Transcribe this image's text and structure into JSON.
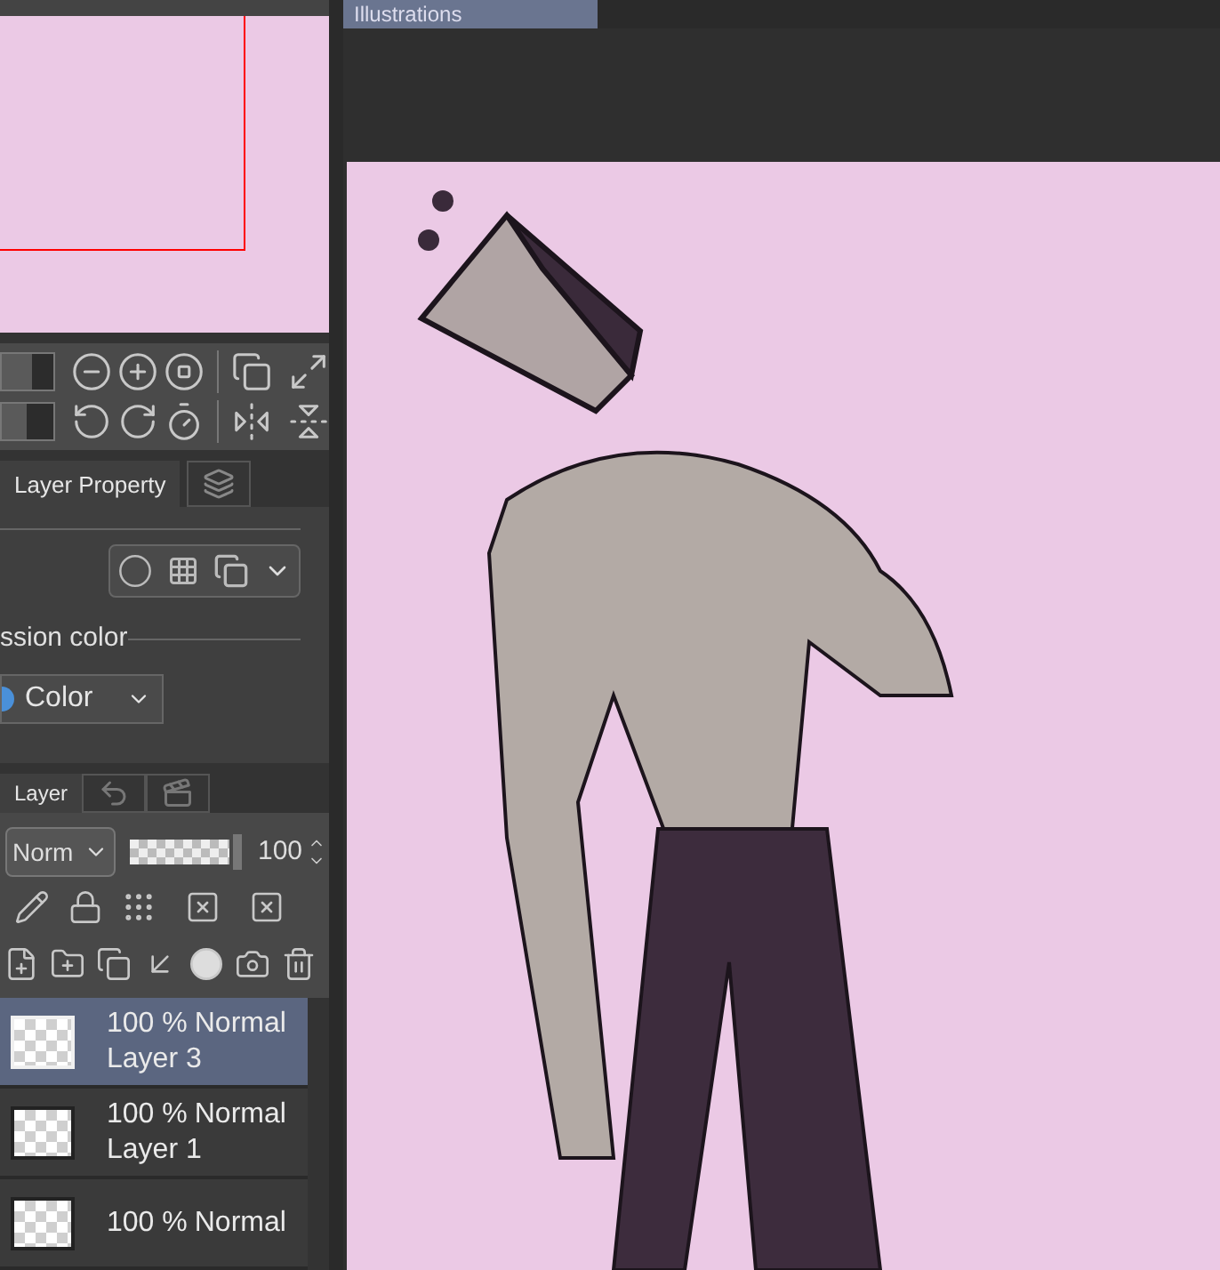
{
  "document_tab": {
    "title": "Illustrations",
    "selected": true
  },
  "zoom_slider": {
    "level": 0.6
  },
  "rotate_slider": {
    "level": 0.5
  },
  "property_tabs": [
    {
      "kind": "text",
      "label": "Layer Property",
      "selected": true
    },
    {
      "kind": "icon",
      "selected": false
    }
  ],
  "layer_property": {
    "expression_label": "ssion color",
    "color_dropdown": "Color"
  },
  "layer_tabs": [
    {
      "kind": "text",
      "label": "Layer",
      "selected": true
    },
    {
      "kind": "undo",
      "selected": false
    },
    {
      "kind": "clapper",
      "selected": false
    }
  ],
  "blend_mode": "Norm",
  "opacity": {
    "level": 1,
    "value": "100"
  },
  "layers": [
    {
      "opacity": "100 %",
      "mode": "Normal",
      "name": "Layer 3",
      "selected": true
    },
    {
      "opacity": "100 %",
      "mode": "Normal",
      "name": "Layer 1",
      "selected": false
    },
    {
      "opacity": "100 %",
      "mode": "Normal",
      "selected": false
    }
  ]
}
